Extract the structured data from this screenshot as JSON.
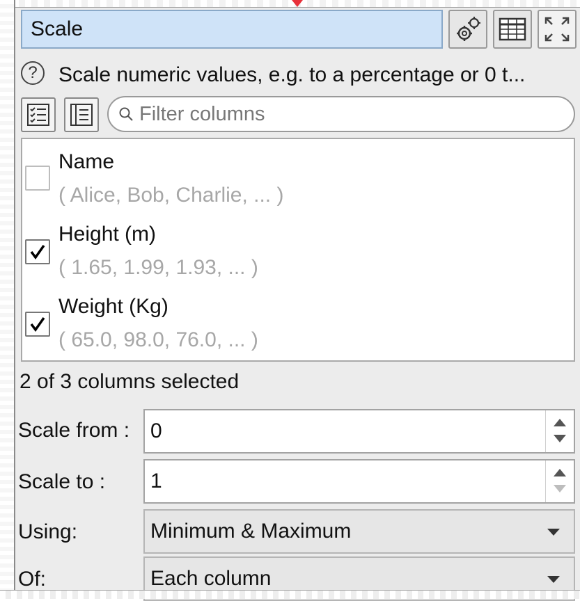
{
  "panel": {
    "title": "Scale",
    "description": "Scale numeric values, e.g. to a percentage or 0 t...",
    "help_icon": "?"
  },
  "toolbar": {
    "icons": [
      "settings-gears-icon",
      "table-icon",
      "expand-icon"
    ]
  },
  "filter": {
    "placeholder": "Filter columns",
    "value": ""
  },
  "columns": [
    {
      "name": "Name",
      "sample": "( Alice, Bob, Charlie, ... )",
      "checked": false
    },
    {
      "name": "Height (m)",
      "sample": "( 1.65, 1.99, 1.93, ... )",
      "checked": true
    },
    {
      "name": "Weight (Kg)",
      "sample": "( 65.0, 98.0, 76.0, ... )",
      "checked": true
    }
  ],
  "status": "2 of 3 columns selected",
  "params": {
    "scale_from": {
      "label": "Scale from :",
      "value": "0"
    },
    "scale_to": {
      "label": "Scale to :",
      "value": "1"
    },
    "using": {
      "label": "Using:",
      "value": "Minimum & Maximum"
    },
    "of": {
      "label": "Of:",
      "value": "Each column"
    }
  },
  "colors": {
    "title_bg": "#cfe3f8",
    "panel_bg": "#ececec",
    "arrow": "#e8313a"
  }
}
